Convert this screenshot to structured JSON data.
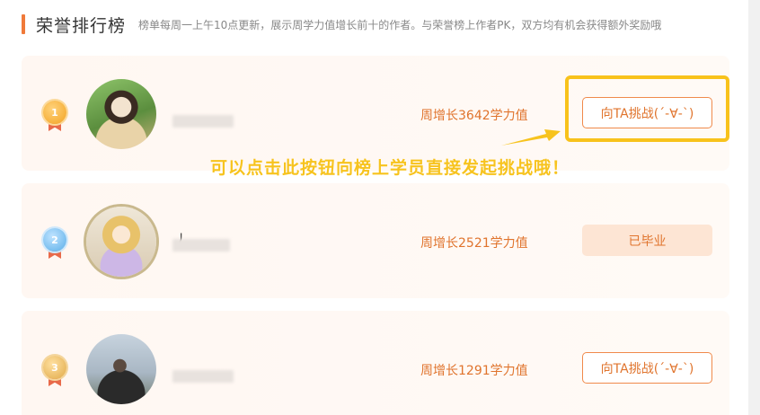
{
  "header": {
    "title": "荣誉排行榜",
    "description": "榜单每周一上午10点更新，展示周学力值增长前十的作者。与荣誉榜上作者PK，双方均有机会获得额外奖励哦"
  },
  "ranking": [
    {
      "rank": "1",
      "name_visible": "",
      "weekly": "周增长3642学力值",
      "action": "向TA挑战(´-∀-`)",
      "action_type": "challenge"
    },
    {
      "rank": "2",
      "name_visible": "丿",
      "weekly": "周增长2521学力值",
      "action": "已毕业",
      "action_type": "graduated"
    },
    {
      "rank": "3",
      "name_visible": "",
      "weekly": "周增长1291学力值",
      "action": "向TA挑战(´-∀-`)",
      "action_type": "challenge"
    }
  ],
  "annotation": {
    "tip": "可以点击此按钮向榜上学员直接发起挑战哦！"
  },
  "colors": {
    "accent": "#e0742d",
    "highlight": "#f8c21b",
    "card_bg": "#fff7f2"
  }
}
